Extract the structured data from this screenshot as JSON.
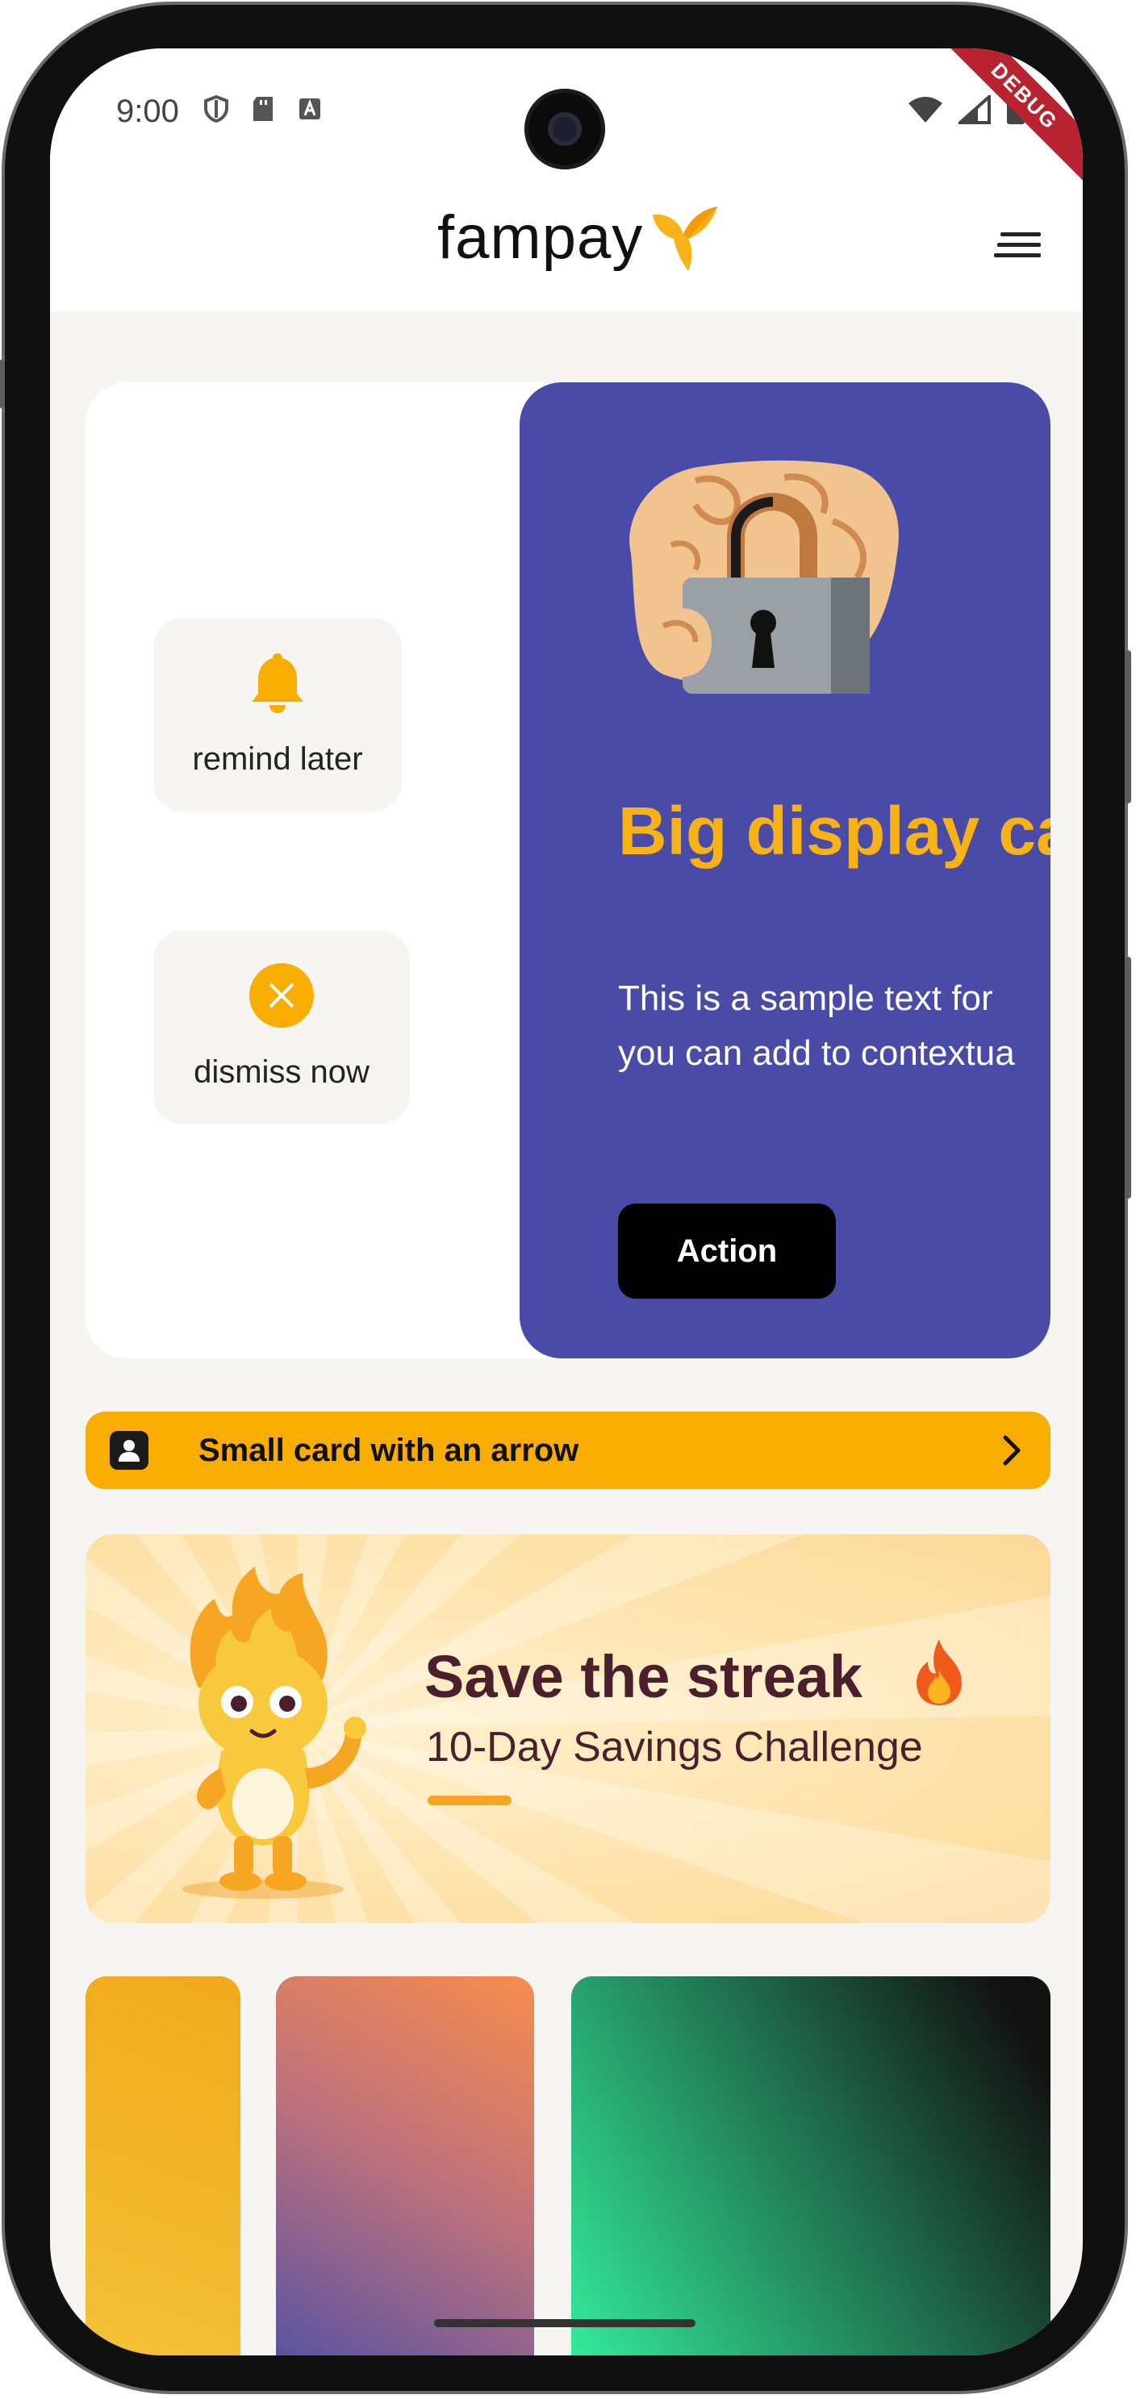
{
  "status_bar": {
    "time": "9:00",
    "left_icons": [
      "shield-icon",
      "sd-card-icon",
      "font-a-icon"
    ],
    "right_icons": [
      "wifi-icon",
      "signal-icon",
      "battery-icon"
    ],
    "debug_ribbon": "DEBUG"
  },
  "header": {
    "logo_text": "fampay",
    "logo_icon": "fampay-bird-icon",
    "menu_icon": "hamburger-menu-icon"
  },
  "contextual_card": {
    "remind_later_label": "remind later",
    "dismiss_now_label": "dismiss now",
    "big_card": {
      "title": "Big display ca",
      "text_line1": "This is a sample text for",
      "text_line2": "you can add to contextua",
      "action_label": "Action",
      "background_color": "#4a4ba6",
      "title_color": "#f7b21a",
      "illustration": "hand-holding-padlock"
    }
  },
  "small_card": {
    "label": "Small card with an arrow",
    "icon": "user-badge-icon",
    "arrow": "chevron-right-icon",
    "background_color": "#f8ad00"
  },
  "streak_banner": {
    "title": "Save the streak",
    "subtitle": "10-Day Savings Challenge",
    "mascot": "flame-mascot"
  },
  "gradient_cards": [
    {
      "colors": [
        "#f1a91c",
        "#f3c33a"
      ]
    },
    {
      "colors": [
        "#f78d4d",
        "#4c4fa6"
      ]
    },
    {
      "colors": [
        "#34f29f",
        "#121212"
      ]
    }
  ]
}
